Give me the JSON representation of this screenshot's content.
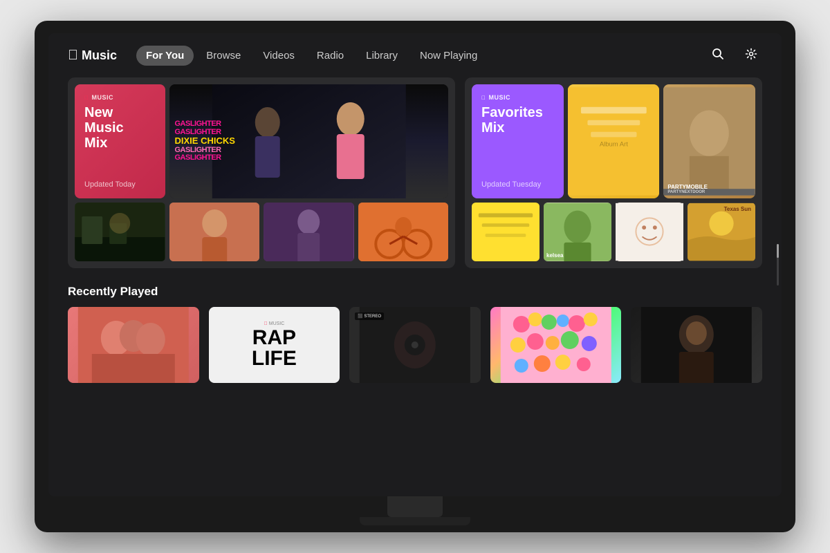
{
  "tv": {
    "app_title": "Music",
    "apple_symbol": ""
  },
  "nav": {
    "logo_text": "Music",
    "items": [
      {
        "id": "for-you",
        "label": "For You",
        "active": true
      },
      {
        "id": "browse",
        "label": "Browse",
        "active": false
      },
      {
        "id": "videos",
        "label": "Videos",
        "active": false
      },
      {
        "id": "radio",
        "label": "Radio",
        "active": false
      },
      {
        "id": "library",
        "label": "Library",
        "active": false
      },
      {
        "id": "now-playing",
        "label": "Now Playing",
        "active": false
      }
    ],
    "search_icon": "🔍",
    "settings_icon": "⚙"
  },
  "featured": {
    "new_music_mix": {
      "label": "MUSIC",
      "title_line1": "New Music",
      "title_line2": "Mix",
      "updated": "Updated Today"
    },
    "gaslighter": {
      "lines": [
        "GASLIGHTER",
        "GASLIGHTER",
        "DIXIE CHICKS",
        "GASLIGHTER",
        "GASLIGHTER"
      ]
    },
    "favorites_mix": {
      "label": "MUSIC",
      "title_line1": "Favorites",
      "title_line2": "Mix",
      "updated": "Updated Tuesday"
    },
    "partymobile": {
      "line1": "PARTYMOBILE",
      "line2": "PARTYNEXTDOOR"
    },
    "texas_sun": "Texas Sun",
    "kelsea": "kelsea"
  },
  "recently_played": {
    "section_title": "Recently Played",
    "items": [
      {
        "id": "r1",
        "type": "album"
      },
      {
        "id": "r2",
        "title": "RAP",
        "subtitle": "LIFE",
        "label": "MUSIC"
      },
      {
        "id": "r3",
        "type": "dark"
      },
      {
        "id": "r4",
        "type": "colorful"
      },
      {
        "id": "r5",
        "type": "portrait"
      }
    ]
  }
}
